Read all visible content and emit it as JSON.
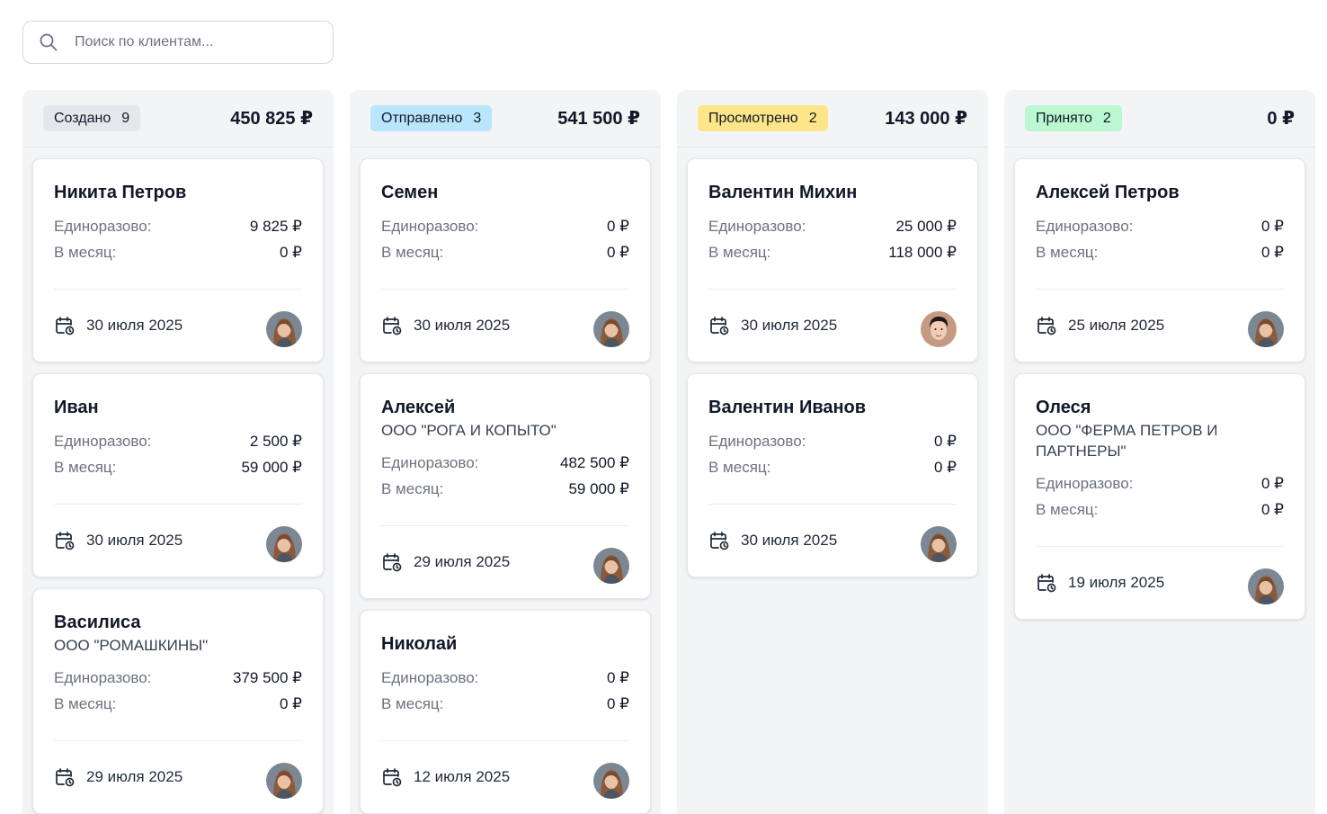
{
  "search": {
    "placeholder": "Поиск по клиентам...",
    "value": ""
  },
  "labels": {
    "once": "Единоразово:",
    "monthly": "В месяц:"
  },
  "columns": [
    {
      "title": "Создано",
      "count": "9",
      "total": "450 825 ₽",
      "badge_color": "#e5e7eb",
      "cards": [
        {
          "name": "Никита Петров",
          "company": "",
          "once": "9 825 ₽",
          "monthly": "0 ₽",
          "date": "30 июля 2025",
          "avatar": "female"
        },
        {
          "name": "Иван",
          "company": "",
          "once": "2 500 ₽",
          "monthly": "59 000 ₽",
          "date": "30 июля 2025",
          "avatar": "female"
        },
        {
          "name": "Василиса",
          "company": "ООО \"РОМАШКИНЫ\"",
          "once": "379 500 ₽",
          "monthly": "0 ₽",
          "date": "29 июля 2025",
          "avatar": "female"
        }
      ]
    },
    {
      "title": "Отправлено",
      "count": "3",
      "total": "541 500 ₽",
      "badge_color": "#bae6fd",
      "cards": [
        {
          "name": "Семен",
          "company": "",
          "once": "0 ₽",
          "monthly": "0 ₽",
          "date": "30 июля 2025",
          "avatar": "female"
        },
        {
          "name": "Алексей",
          "company": "ООО \"РОГА И КОПЫТО\"",
          "once": "482 500 ₽",
          "monthly": "59 000 ₽",
          "date": "29 июля 2025",
          "avatar": "female"
        },
        {
          "name": "Николай",
          "company": "",
          "once": "0 ₽",
          "monthly": "0 ₽",
          "date": "12 июля 2025",
          "avatar": "female"
        }
      ]
    },
    {
      "title": "Просмотрено",
      "count": "2",
      "total": "143 000 ₽",
      "badge_color": "#fde68a",
      "cards": [
        {
          "name": "Валентин Михин",
          "company": "",
          "once": "25 000 ₽",
          "monthly": "118 000 ₽",
          "date": "30 июля 2025",
          "avatar": "male"
        },
        {
          "name": "Валентин Иванов",
          "company": "",
          "once": "0 ₽",
          "monthly": "0 ₽",
          "date": "30 июля 2025",
          "avatar": "female"
        }
      ]
    },
    {
      "title": "Принято",
      "count": "2",
      "total": "0 ₽",
      "badge_color": "#bbf7d0",
      "cards": [
        {
          "name": "Алексей Петров",
          "company": "",
          "once": "0 ₽",
          "monthly": "0 ₽",
          "date": "25 июля 2025",
          "avatar": "female"
        },
        {
          "name": "Олеся",
          "company": "ООО \"ФЕРМА ПЕТРОВ И ПАРТНЕРЫ\"",
          "once": "0 ₽",
          "monthly": "0 ₽",
          "date": "19 июля 2025",
          "avatar": "female"
        }
      ]
    }
  ]
}
